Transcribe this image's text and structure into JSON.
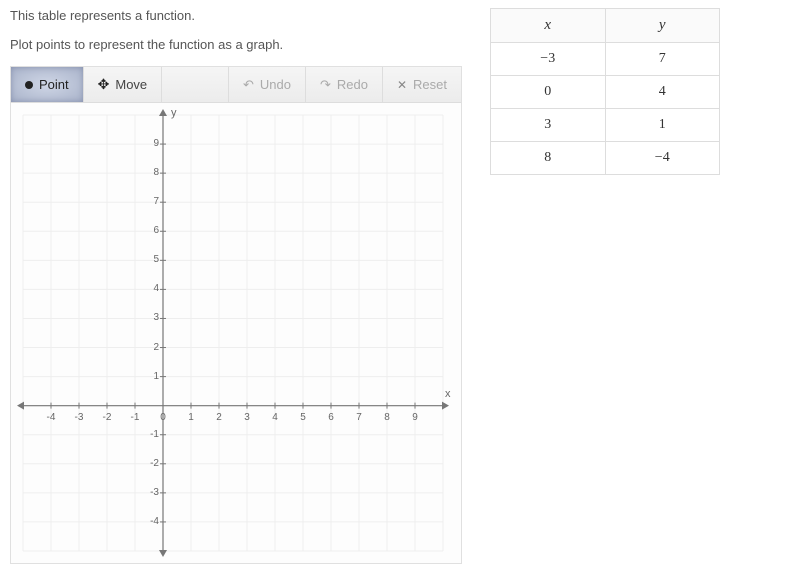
{
  "instructions": {
    "line1": "This table represents a function.",
    "line2": "Plot points to represent the function as a graph."
  },
  "toolbar": {
    "point": "Point",
    "move": "Move",
    "undo": "Undo",
    "redo": "Redo",
    "reset": "Reset"
  },
  "axes": {
    "x_label": "x",
    "y_label": "y"
  },
  "table": {
    "head_x": "x",
    "head_y": "y",
    "rows": [
      {
        "x": "−3",
        "y": "7"
      },
      {
        "x": "0",
        "y": "4"
      },
      {
        "x": "3",
        "y": "1"
      },
      {
        "x": "8",
        "y": "−4"
      }
    ]
  },
  "chart_data": {
    "type": "scatter",
    "title": "",
    "xlabel": "x",
    "ylabel": "y",
    "xlim": [
      -5,
      10
    ],
    "ylim": [
      -5,
      10
    ],
    "xticks": [
      -5,
      -4,
      -3,
      -2,
      -1,
      0,
      1,
      2,
      3,
      4,
      5,
      6,
      7,
      8,
      9,
      10
    ],
    "yticks": [
      -5,
      -4,
      -3,
      -2,
      -1,
      0,
      1,
      2,
      3,
      4,
      5,
      6,
      7,
      8,
      9,
      10
    ],
    "grid": true,
    "series": [
      {
        "name": "plotted_points",
        "x": [],
        "y": []
      }
    ]
  }
}
